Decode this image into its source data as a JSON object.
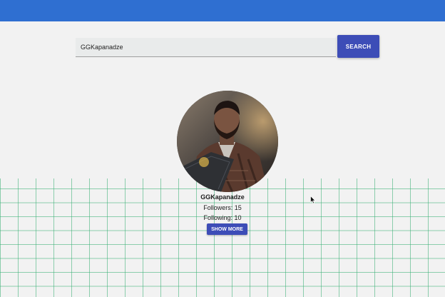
{
  "search": {
    "value": "GGKapanadze",
    "button_label": "SEARCH"
  },
  "profile": {
    "username": "GGKapanadze",
    "followers_text": "Followers: 15",
    "following_text": "Following: 10",
    "show_more_label": "SHOW MORE"
  },
  "colors": {
    "header": "#2f6fd1",
    "button": "#3d4db7",
    "background": "#f2f2f2",
    "grid_lines": "#37af73"
  },
  "icons": {
    "cursor": "mouse-pointer-icon"
  }
}
